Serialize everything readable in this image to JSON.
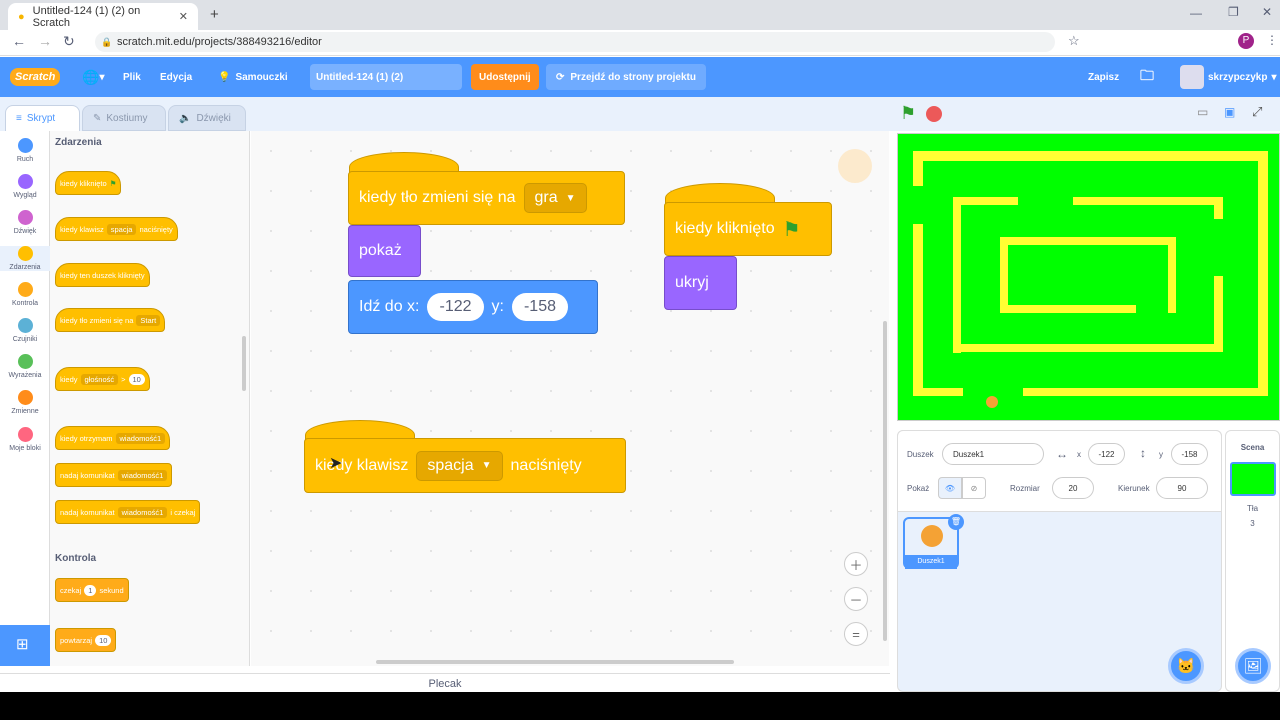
{
  "browser": {
    "tab_title": "Untitled-124 (1) (2) on Scratch",
    "url": "scratch.mit.edu/projects/388493216/editor",
    "profile_initial": "P"
  },
  "menu": {
    "logo": "Scratch",
    "file": "Plik",
    "edit": "Edycja",
    "tutorials": "Samouczki",
    "project_title": "Untitled-124 (1) (2)",
    "share": "Udostępnij",
    "see_project": "Przejdź do strony projektu",
    "save": "Zapisz",
    "username": "skrzypczykp"
  },
  "tabs": {
    "code": "Skrypt",
    "costumes": "Kostiumy",
    "sounds": "Dźwięki"
  },
  "categories": [
    {
      "label": "Ruch",
      "color": "#4c97ff"
    },
    {
      "label": "Wygląd",
      "color": "#9966ff"
    },
    {
      "label": "Dźwięk",
      "color": "#cf63cf"
    },
    {
      "label": "Zdarzenia",
      "color": "#ffbf00"
    },
    {
      "label": "Kontrola",
      "color": "#ffab19"
    },
    {
      "label": "Czujniki",
      "color": "#5cb1d6"
    },
    {
      "label": "Wyrażenia",
      "color": "#59c059"
    },
    {
      "label": "Zmienne",
      "color": "#ff8c1a"
    },
    {
      "label": "Moje bloki",
      "color": "#ff6680"
    }
  ],
  "palette": {
    "events_title": "Zdarzenia",
    "when_flag": "kiedy kliknięto",
    "when_key_a": "kiedy klawisz",
    "when_key_dd": "spacja",
    "when_key_b": "naciśnięty",
    "when_sprite_clicked": "kiedy ten duszek kliknięty",
    "when_backdrop": "kiedy tło zmieni się na",
    "when_backdrop_dd": "Start",
    "when_loud": "kiedy",
    "when_loud_dd": "głośność",
    "when_loud_op": ">",
    "when_loud_val": "10",
    "when_receive": "kiedy otrzymam",
    "msg_dd": "wiadomość1",
    "broadcast": "nadaj komunikat",
    "broadcast_wait": "nadaj komunikat",
    "broadcast_wait_tail": "i czekaj",
    "control_title": "Kontrola",
    "wait_a": "czekaj",
    "wait_val": "1",
    "wait_b": "sekund",
    "repeat": "powtarzaj",
    "repeat_val": "10"
  },
  "workspace": {
    "script1_hat": "kiedy tło zmieni się na",
    "script1_dd": "gra",
    "script1_show": "pokaż",
    "script1_goto": "Idź do x:",
    "script1_x": "-122",
    "script1_y_label": "y:",
    "script1_y": "-158",
    "script2_hat": "kiedy kliknięto",
    "script2_hide": "ukryj",
    "script3_a": "kiedy klawisz",
    "script3_dd": "spacja",
    "script3_b": "naciśnięty"
  },
  "backpack": "Plecak",
  "sprite_info": {
    "sprite_label": "Duszek",
    "sprite_name": "Duszek1",
    "x_label": "x",
    "x": "-122",
    "y_label": "y",
    "y": "-158",
    "show_label": "Pokaż",
    "size_label": "Rozmiar",
    "size": "20",
    "direction_label": "Kierunek",
    "direction": "90",
    "thumb_name": "Duszek1"
  },
  "scene": {
    "title": "Scena",
    "backdrops_label": "Tła",
    "backdrops_count": "3"
  }
}
